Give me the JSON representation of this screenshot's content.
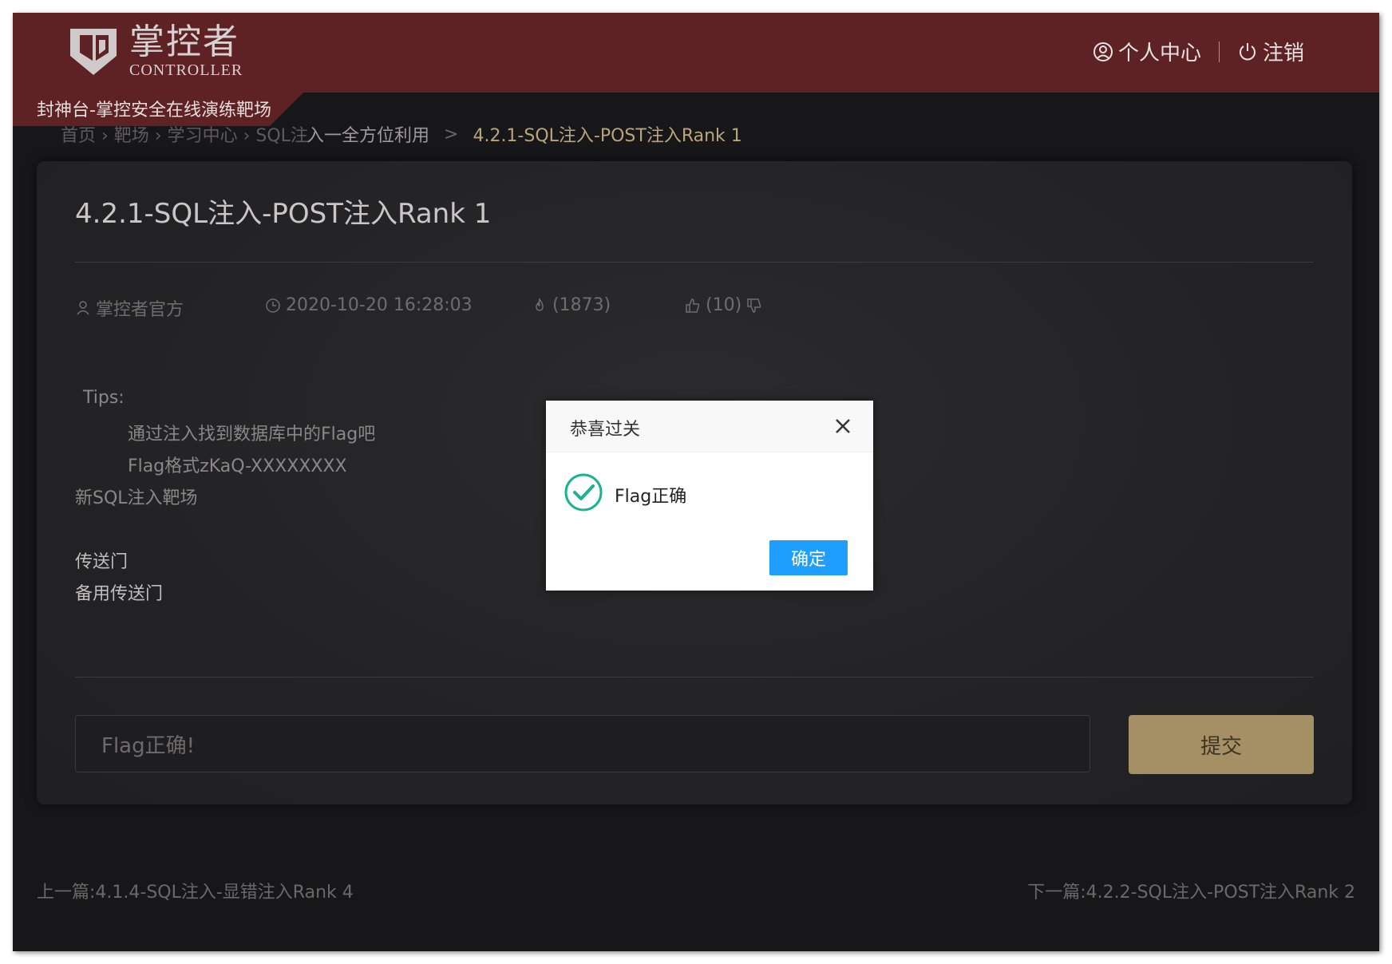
{
  "header": {
    "logo_cn": "掌控者",
    "logo_en": "CONTROLLER",
    "subtitle": "封神台-掌控安全在线演练靶场",
    "user_center": "个人中心",
    "logout": "注销"
  },
  "breadcrumb": {
    "hidden_text": "首页 › 靶场 › 学习中心 › SQL注",
    "parent": "入一全方位利用",
    "separator": ">",
    "current": "4.2.1-SQL注入-POST注入Rank 1"
  },
  "article": {
    "title": "4.2.1-SQL注入-POST注入Rank 1",
    "author": "掌控者官方",
    "datetime": "2020-10-20 16:28:03",
    "views": "(1873)",
    "likes": "(10)",
    "tips_label": "Tips:",
    "tip1": "通过注入找到数据库中的Flag吧",
    "tip2": "Flag格式zKaQ-XXXXXXXX",
    "note": "新SQL注入靶场",
    "link1": "传送门",
    "link2": "备用传送门"
  },
  "form": {
    "input_value": "Flag正确!",
    "submit_label": "提交"
  },
  "footer_nav": {
    "prev": "上一篇:4.1.4-SQL注入-显错注入Rank 4",
    "next": "下一篇:4.2.2-SQL注入-POST注入Rank 2"
  },
  "modal": {
    "title": "恭喜过关",
    "message": "Flag正确",
    "ok_label": "确定"
  },
  "colors": {
    "header_bg": "#5e2124",
    "page_bg": "#17171a",
    "accent_gold": "#a59066",
    "modal_button": "#1e9fff",
    "success_green": "#19b394"
  },
  "icons": [
    "user-circle-icon",
    "power-icon",
    "user-icon",
    "clock-icon",
    "fire-icon",
    "thumbs-up-icon",
    "thumbs-down-icon",
    "close-icon",
    "check-circle-icon"
  ]
}
